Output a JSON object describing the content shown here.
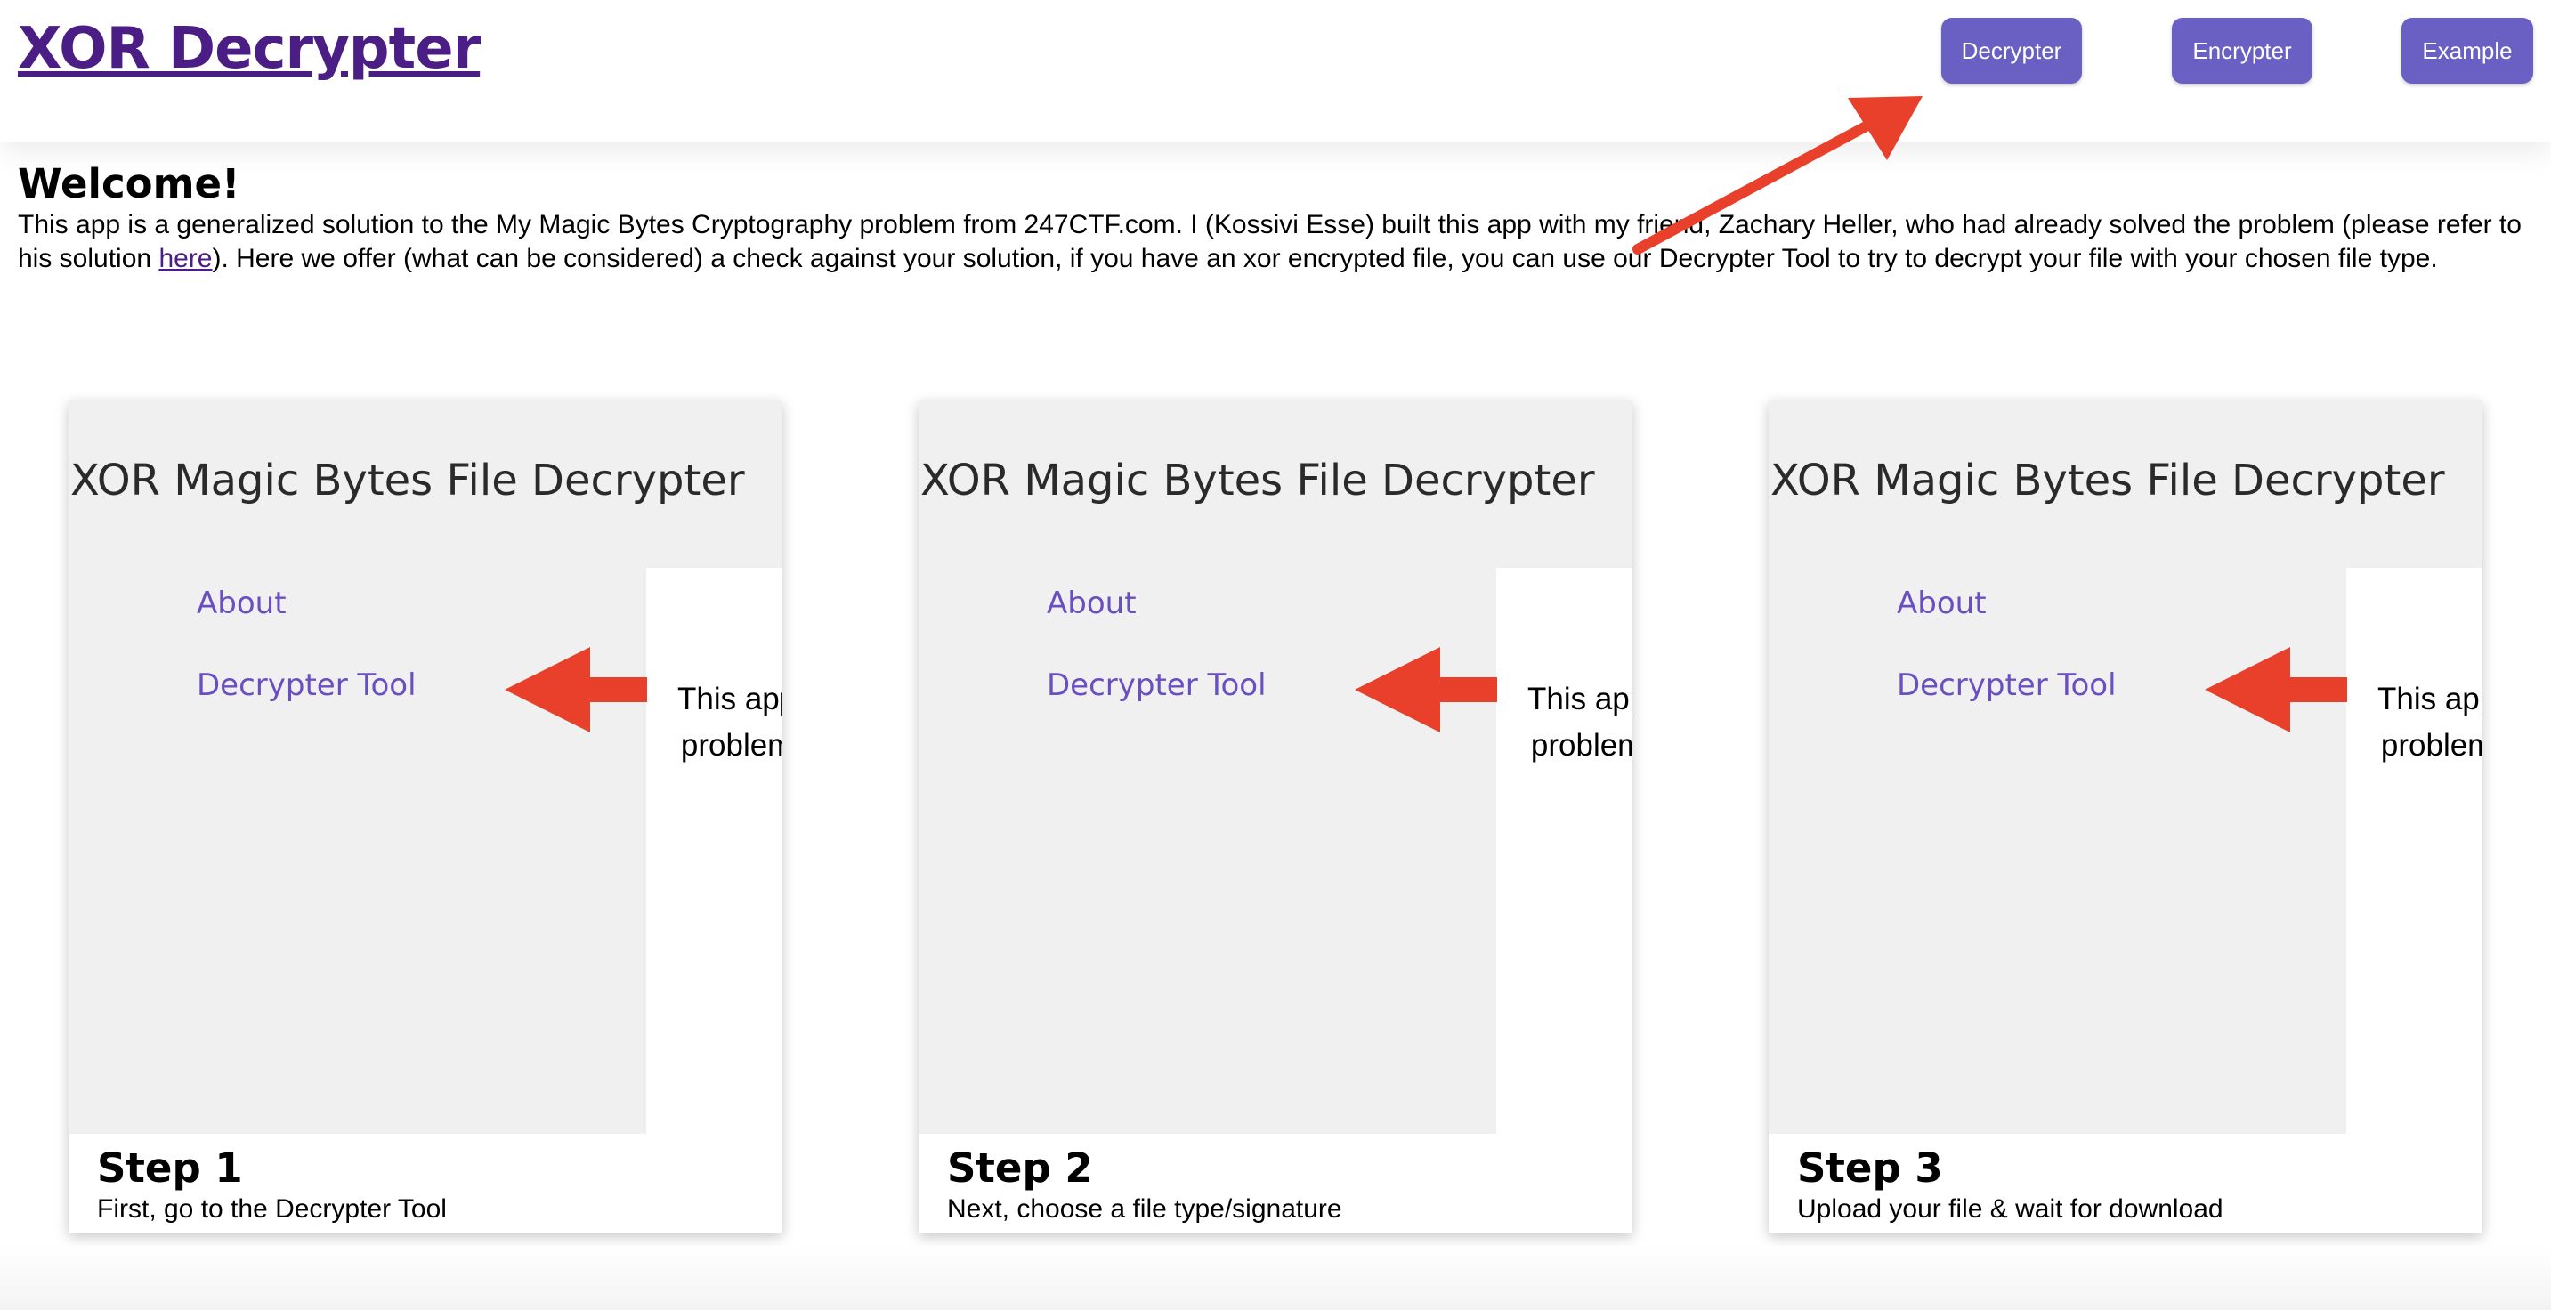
{
  "header": {
    "title": "XOR Decrypter",
    "nav": [
      {
        "label": "Decrypter"
      },
      {
        "label": "Encrypter"
      },
      {
        "label": "Example"
      }
    ]
  },
  "welcome": {
    "title": "Welcome!",
    "intro_before_link": "This app is a generalized solution to the My Magic Bytes Cryptography problem from 247CTF.com. I (Kossivi Esse) built this app with my friend, Zachary Heller, who had already solved the problem (please refer to his solution ",
    "link_text": "here",
    "intro_after_link": "). Here we offer (what can be considered) a check against your solution, if you have an xor encrypted file, you can use our Decrypter Tool to try to decrypt your file with your chosen file type."
  },
  "steps": [
    {
      "preview_title": "XOR Magic Bytes File Decrypter",
      "preview_about": "About",
      "preview_tool": "Decrypter Tool",
      "preview_text_1": "This app",
      "preview_text_2": "problem",
      "title": "Step 1",
      "description": "First, go to the Decrypter Tool"
    },
    {
      "preview_title": "XOR Magic Bytes File Decrypter",
      "preview_about": "About",
      "preview_tool": "Decrypter Tool",
      "preview_text_1": "This app",
      "preview_text_2": "problem",
      "title": "Step 2",
      "description": "Next, choose a file type/signature"
    },
    {
      "preview_title": "XOR Magic Bytes File Decrypter",
      "preview_about": "About",
      "preview_tool": "Decrypter Tool",
      "preview_text_1": "This app",
      "preview_text_2": "problem",
      "title": "Step 3",
      "description": "Upload your file & wait for download"
    }
  ],
  "colors": {
    "accent": "#6a5fc3",
    "link": "#4b1e86",
    "arrow": "#e8402a"
  },
  "icons": {
    "annotation_arrow": "red-arrow-icon"
  }
}
